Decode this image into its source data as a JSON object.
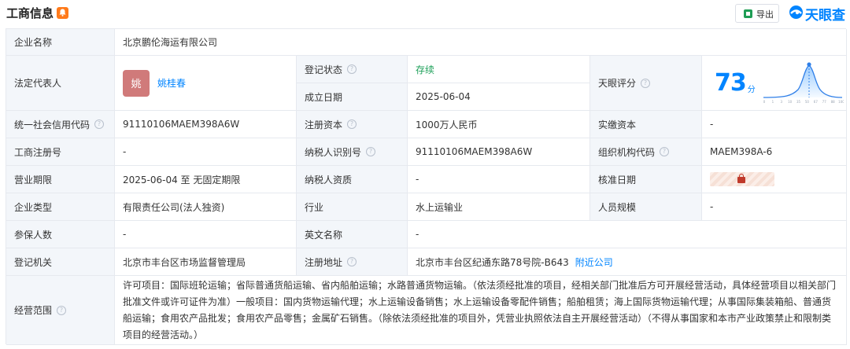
{
  "header": {
    "title": "工商信息",
    "export_label": "导出",
    "brand": "天眼查"
  },
  "rows": {
    "company_name": {
      "label": "企业名称",
      "value": "北京鹏伦海运有限公司"
    },
    "legal_rep": {
      "label": "法定代表人",
      "avatar_char": "姚",
      "name": "姚桂春"
    },
    "reg_status": {
      "label": "登记状态",
      "value": "存续",
      "status_color": "#1ea05a"
    },
    "established": {
      "label": "成立日期",
      "value": "2025-06-04"
    },
    "tianyan_score": {
      "label": "天眼评分",
      "score": "73",
      "unit": "分",
      "ticks": [
        "0",
        "1",
        "3",
        "10",
        "35",
        "50",
        "67",
        "77",
        "88",
        "100"
      ]
    },
    "credit_code": {
      "label": "统一社会信用代码",
      "value": "91110106MAEM398A6W"
    },
    "reg_capital": {
      "label": "注册资本",
      "value": "1000万人民币"
    },
    "paid_capital": {
      "label": "实缴资本",
      "value": "-"
    },
    "biz_reg_no": {
      "label": "工商注册号",
      "value": "-"
    },
    "taxpayer_id": {
      "label": "纳税人识别号",
      "value": "91110106MAEM398A6W"
    },
    "org_code": {
      "label": "组织机构代码",
      "value": "MAEM398A-6"
    },
    "biz_term": {
      "label": "营业期限",
      "value": "2025-06-04 至 无固定期限"
    },
    "taxpayer_qual": {
      "label": "纳税人资质",
      "value": "-"
    },
    "approval_date": {
      "label": "核准日期"
    },
    "company_type": {
      "label": "企业类型",
      "value": "有限责任公司(法人独资)"
    },
    "industry": {
      "label": "行业",
      "value": "水上运输业"
    },
    "staff_size": {
      "label": "人员规模",
      "value": "-"
    },
    "insured": {
      "label": "参保人数",
      "value": "-"
    },
    "english_name": {
      "label": "英文名称",
      "value": "-"
    },
    "reg_authority": {
      "label": "登记机关",
      "value": "北京市丰台区市场监督管理局"
    },
    "reg_address": {
      "label": "注册地址",
      "value": "北京市丰台区纪通东路78号院-B643",
      "link": "附近公司"
    },
    "biz_scope": {
      "label": "经营范围",
      "value": "许可项目：国际班轮运输；省际普通货船运输、省内船舶运输；水路普通货物运输。（依法须经批准的项目，经相关部门批准后方可开展经营活动，具体经营项目以相关部门批准文件或许可证件为准）一般项目：国内货物运输代理；水上运输设备销售；水上运输设备零配件销售；船舶租赁；海上国际货物运输代理；从事国际集装箱船、普通货船运输；食用农产品批发；食用农产品零售；金属矿石销售。（除依法须经批准的项目外，凭营业执照依法自主开展经营活动）（不得从事国家和本市产业政策禁止和限制类项目的经营活动。）"
    }
  }
}
